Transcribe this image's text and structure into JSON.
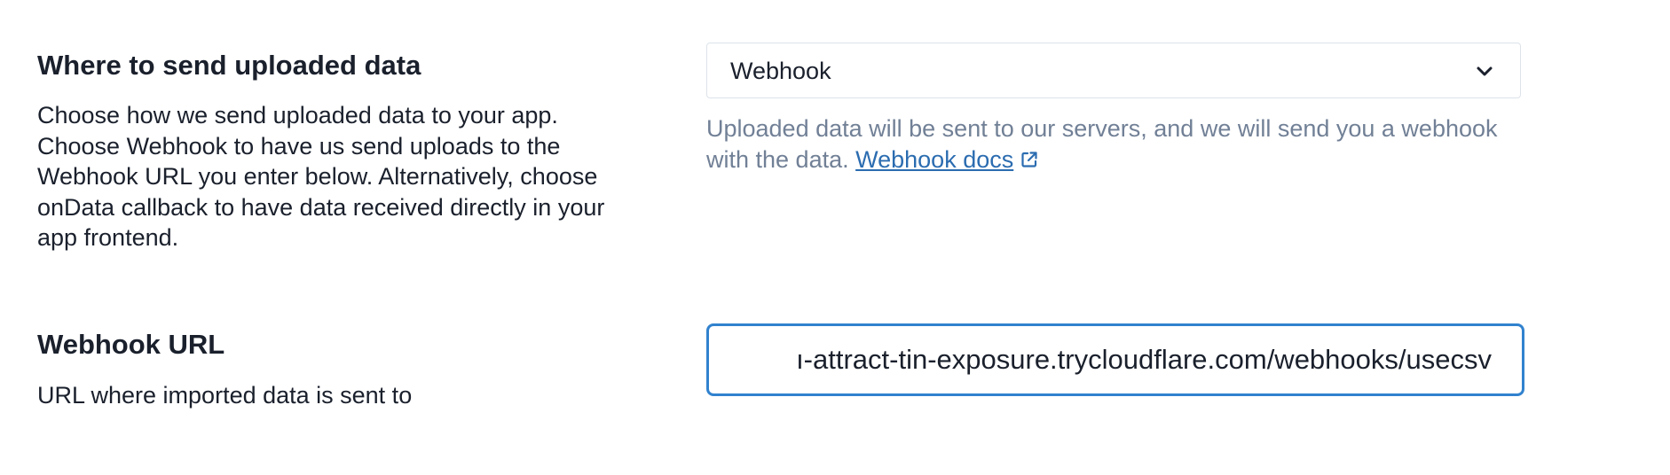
{
  "destination": {
    "title": "Where to send uploaded data",
    "description": "Choose how we send uploaded data to your app. Choose Webhook to have us send uploads to the Webhook URL you enter below. Alternatively, choose onData callback to have data received directly in your app frontend.",
    "select_value": "Webhook",
    "help_text": "Uploaded data will be sent to our servers, and we will send you a webhook with the data.",
    "help_link_label": "Webhook docs"
  },
  "webhook_url": {
    "title": "Webhook URL",
    "description": "URL where imported data is sent to",
    "value": "ı-attract-tin-exposure.trycloudflare.com/webhooks/usecsv"
  },
  "colors": {
    "accent": "#3182ce",
    "link": "#2b6cb0",
    "muted_text": "#718096",
    "text": "#1a202c",
    "border": "#dde3ea"
  }
}
